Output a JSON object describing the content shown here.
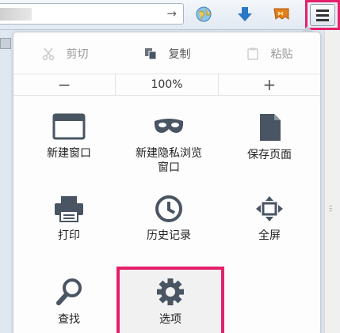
{
  "toolbar": {
    "url_go": "→",
    "icons": [
      "world-icon",
      "download-icon",
      "bookmark-icon"
    ],
    "menu_icon": "hamburger-icon"
  },
  "menu": {
    "edit": {
      "cut": "剪切",
      "copy": "复制",
      "paste": "粘贴"
    },
    "zoom": {
      "out": "−",
      "level": "100%",
      "in": "+"
    },
    "items": {
      "new_window": "新建窗口",
      "new_private_line1": "新建隐私浏览",
      "new_private_line2": "窗口",
      "save_page": "保存页面",
      "print": "打印",
      "history": "历史记录",
      "fullscreen": "全屏",
      "find": "查找",
      "options": "选项"
    }
  },
  "colors": {
    "highlight": "#e5206b",
    "icon": "#4a5563"
  }
}
